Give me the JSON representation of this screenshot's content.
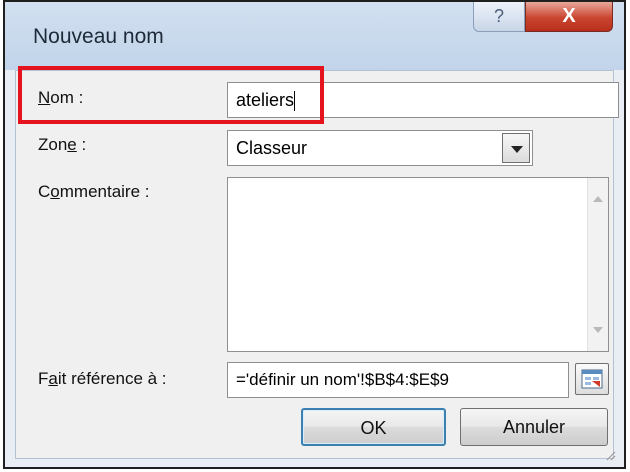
{
  "window": {
    "title": "Nouveau nom",
    "help_label": "?",
    "close_label": "X"
  },
  "form": {
    "name": {
      "label_mnemonic": "N",
      "label_rest": "om :",
      "value": "ateliers"
    },
    "zone": {
      "label_start": "Zon",
      "label_mnemonic": "e",
      "label_end": " :",
      "value": "Classeur"
    },
    "comment": {
      "label_start": "C",
      "label_mnemonic": "o",
      "label_end": "mmentaire :",
      "value": ""
    },
    "reference": {
      "label_start": "F",
      "label_mnemonic": "a",
      "label_end": "it référence à :",
      "value": "='définir un nom'!$B$4:$E$9"
    }
  },
  "buttons": {
    "ok_label": "OK",
    "cancel_label": "Annuler"
  },
  "colors": {
    "highlight": "#e5131d",
    "close_button": "#c9452f",
    "title_bar": "#c1d4ea"
  },
  "icons": {
    "reference_picker": "collapse-dialog-icon",
    "resize": "resize-grip-icon"
  }
}
